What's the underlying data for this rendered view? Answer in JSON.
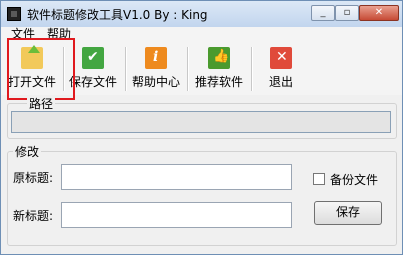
{
  "window": {
    "title": "软件标题修改工具V1.0 By : King"
  },
  "menu": {
    "file": "文件",
    "help": "帮助"
  },
  "toolbar": {
    "open": "打开文件",
    "save": "保存文件",
    "help": "帮助中心",
    "recommend": "推荐软件",
    "exit": "退出"
  },
  "path_group": {
    "label": "路径",
    "value": ""
  },
  "modify_group": {
    "label": "修改",
    "original_label": "原标题:",
    "original_value": "",
    "new_label": "新标题:",
    "new_value": "",
    "backup_label": "备份文件",
    "backup_checked": false,
    "save_button": "保存"
  },
  "colors": {
    "highlight": "#e0191e",
    "open_icon": "#6bbd3a",
    "save_icon": "#43a641",
    "help_icon": "#ee8a1e",
    "recommend_icon": "#4a9a2e",
    "exit_icon": "#e04a3a"
  }
}
